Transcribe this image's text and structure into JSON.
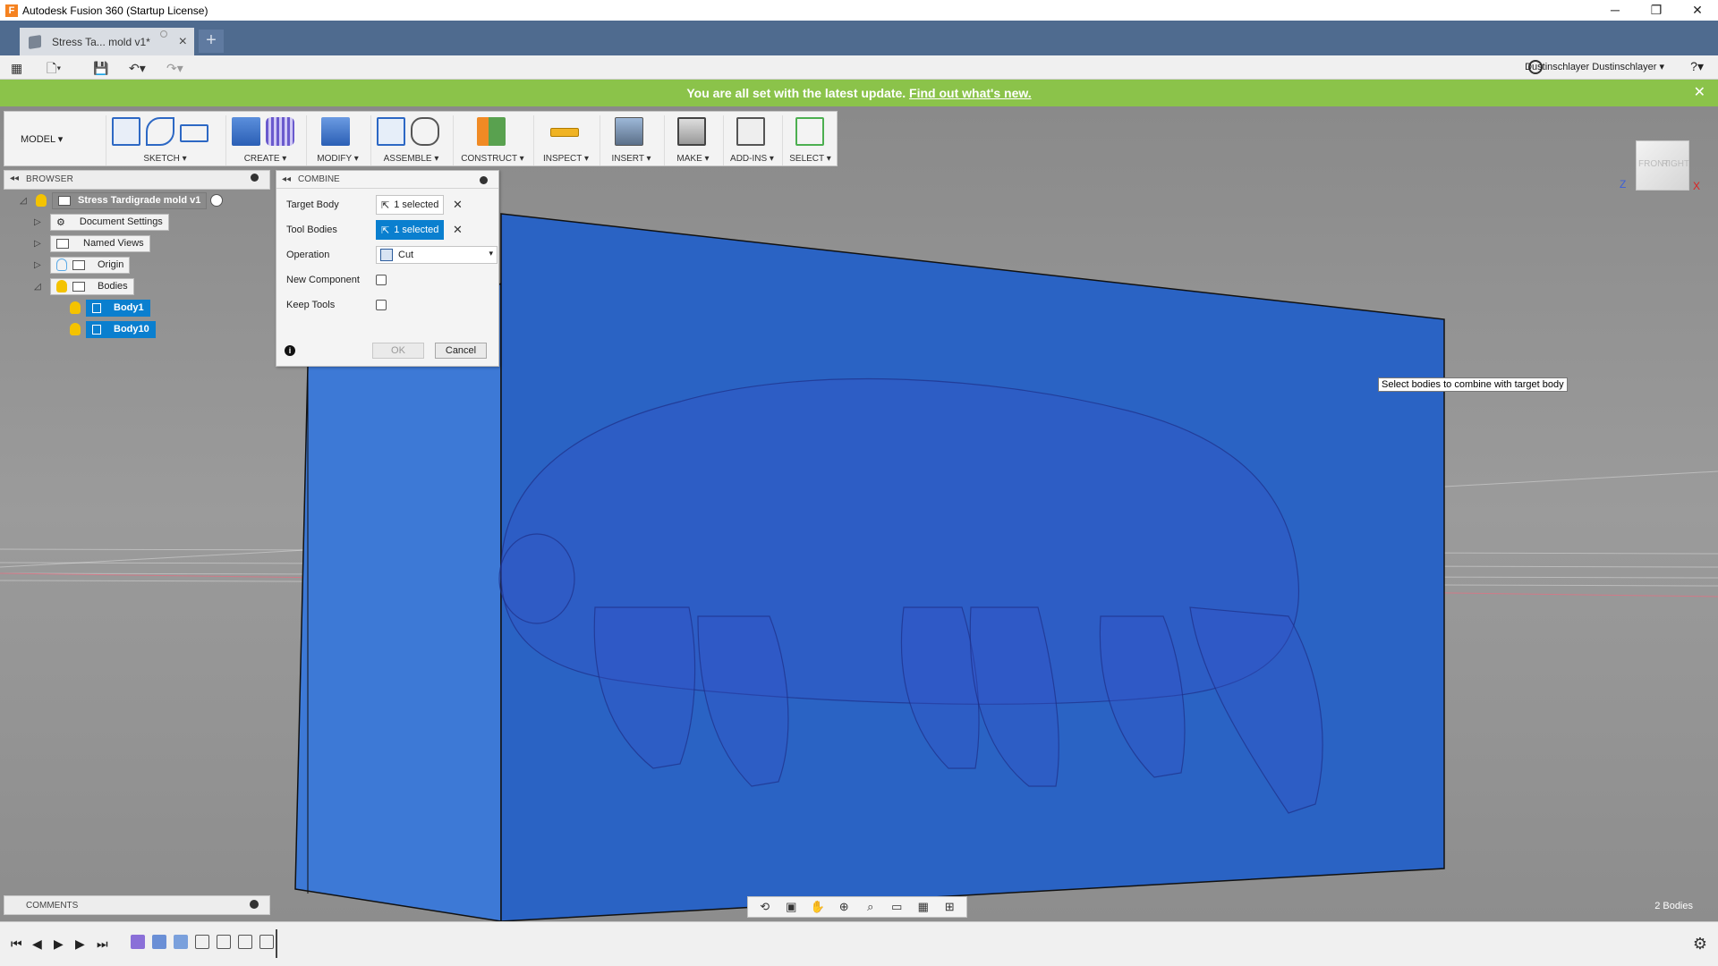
{
  "window": {
    "title": "Autodesk Fusion 360 (Startup License)",
    "minimize": "─",
    "restore": "❐",
    "close": "✕"
  },
  "tab": {
    "label": "Stress Ta... mold v1*",
    "new_tab": "+"
  },
  "user": {
    "name": "Dustinschlayer Dustinschlayer ▾"
  },
  "banner": {
    "message": "You are all set with the latest update.",
    "link": "Find out what's new."
  },
  "ribbon": {
    "mode": "MODEL ▾",
    "groups": [
      "SKETCH ▾",
      "CREATE ▾",
      "MODIFY ▾",
      "ASSEMBLE ▾",
      "CONSTRUCT ▾",
      "INSPECT ▾",
      "INSERT ▾",
      "MAKE ▾",
      "ADD-INS ▾",
      "SELECT ▾"
    ]
  },
  "browser": {
    "header": "BROWSER",
    "root": "Stress Tardigrade mold v1",
    "items": [
      "Document Settings",
      "Named Views",
      "Origin",
      "Bodies"
    ],
    "bodies": [
      "Body1",
      "Body10"
    ]
  },
  "combine": {
    "title": "COMBINE",
    "target_body_label": "Target Body",
    "target_body_value": "1 selected",
    "tool_bodies_label": "Tool Bodies",
    "tool_bodies_value": "1 selected",
    "operation_label": "Operation",
    "operation_value": "Cut",
    "new_component_label": "New Component",
    "new_component_checked": false,
    "keep_tools_label": "Keep Tools",
    "keep_tools_checked": false,
    "ok": "OK",
    "cancel": "Cancel"
  },
  "tooltip": "Select bodies to combine with target body",
  "viewcube": {
    "face_front": "FRONT",
    "face_right": "RIGHT",
    "z_axis": "Z",
    "x_axis": "X"
  },
  "comments": {
    "header": "COMMENTS"
  },
  "status": {
    "bodies_count": "2 Bodies"
  },
  "colors": {
    "accent": "#0a7fcf",
    "banner": "#8bc34a",
    "tab_strip": "#4f6b8f",
    "body_blue": "#2a63c4"
  },
  "icons": [
    "apps-grid-icon",
    "file-icon",
    "save-icon",
    "undo-icon",
    "redo-icon",
    "clock-icon",
    "help-icon"
  ]
}
